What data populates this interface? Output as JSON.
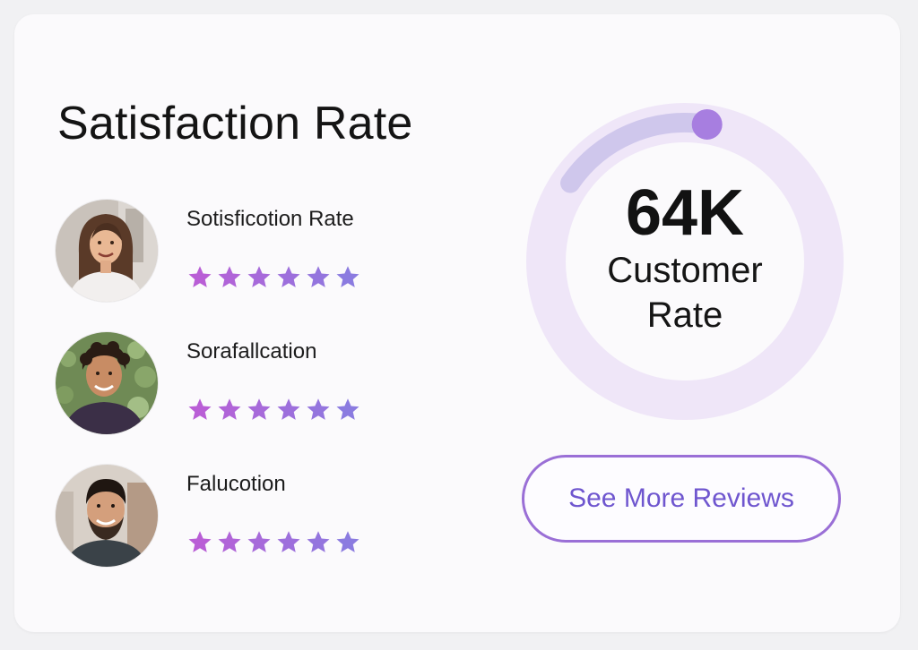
{
  "title": "Satisfaction Rate",
  "reviews": [
    {
      "name": "Sotisficotion Rate",
      "rating": 6,
      "max_rating": 6
    },
    {
      "name": "Sorafallcation",
      "rating": 6,
      "max_rating": 6
    },
    {
      "name": "Falucotion",
      "rating": 6,
      "max_rating": 6
    }
  ],
  "summary": {
    "value": "64K",
    "label": "Customer Rate",
    "progress": 0.18
  },
  "cta": {
    "label": "See More Reviews"
  },
  "colors": {
    "accent": "#9a6fd6",
    "cta_text": "#6f56cf",
    "star_start": "#b95ed6",
    "star_end": "#8b7be0",
    "ring_track": "#efe6f8",
    "ring_fill": "#cfc7ec",
    "ring_knob": "#a77ee0"
  },
  "icons": {
    "star": "star-icon",
    "avatars": [
      "avatar-woman-long-hair",
      "avatar-man-curly-hair",
      "avatar-man-beard"
    ]
  }
}
